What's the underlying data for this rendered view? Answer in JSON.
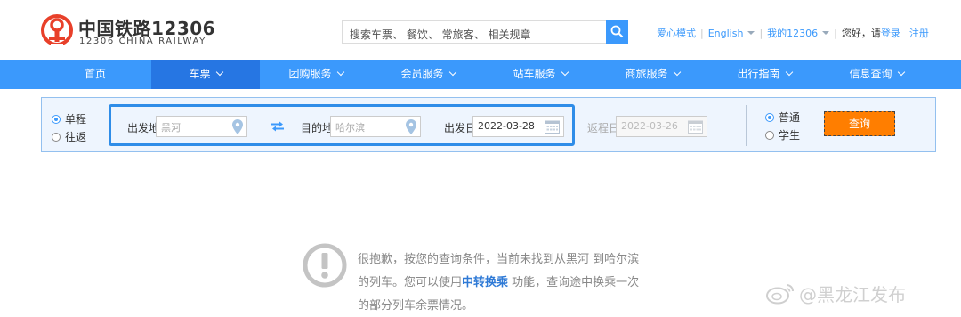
{
  "brand": {
    "cn": "中国铁路12306",
    "en": "12306 CHINA RAILWAY",
    "color": "#e8402a"
  },
  "search": {
    "placeholder": "搜索车票、 餐饮、 常旅客、 相关规章",
    "icon": "search-icon"
  },
  "toplinks": {
    "care_mode": "爱心模式",
    "language": "English",
    "my12306": "我的12306",
    "greeting": "您好，请",
    "login": "登录",
    "register": "注册"
  },
  "nav": {
    "items": [
      {
        "label": "首页",
        "has_dropdown": false,
        "active": false
      },
      {
        "label": "车票",
        "has_dropdown": true,
        "active": true
      },
      {
        "label": "团购服务",
        "has_dropdown": true,
        "active": false
      },
      {
        "label": "会员服务",
        "has_dropdown": true,
        "active": false
      },
      {
        "label": "站车服务",
        "has_dropdown": true,
        "active": false
      },
      {
        "label": "商旅服务",
        "has_dropdown": true,
        "active": false
      },
      {
        "label": "出行指南",
        "has_dropdown": true,
        "active": false
      },
      {
        "label": "信息查询",
        "has_dropdown": true,
        "active": false
      }
    ],
    "color": "#3b99fc"
  },
  "query": {
    "trip_oneway": "单程",
    "trip_return": "往返",
    "from_label": "出发地",
    "from_value": "黑河",
    "to_label": "目的地",
    "to_value": "哈尔滨",
    "depart_label": "出发日",
    "depart_value": "2022-03-28",
    "return_label": "返程日",
    "return_value": "2022-03-26",
    "type_normal": "普通",
    "type_student": "学生",
    "submit": "查询",
    "submit_color": "#ff7e00"
  },
  "result": {
    "line1": "很抱歉，按您的查询条件，当前未找到从黑河 到哈尔滨",
    "line2_pre": "的列车。您可以使用",
    "line2_link": "中转换乘",
    "line2_post": " 功能，查询途中换乘一次",
    "line3": "的部分列车余票情况。"
  },
  "watermark": "@黑龙江发布"
}
